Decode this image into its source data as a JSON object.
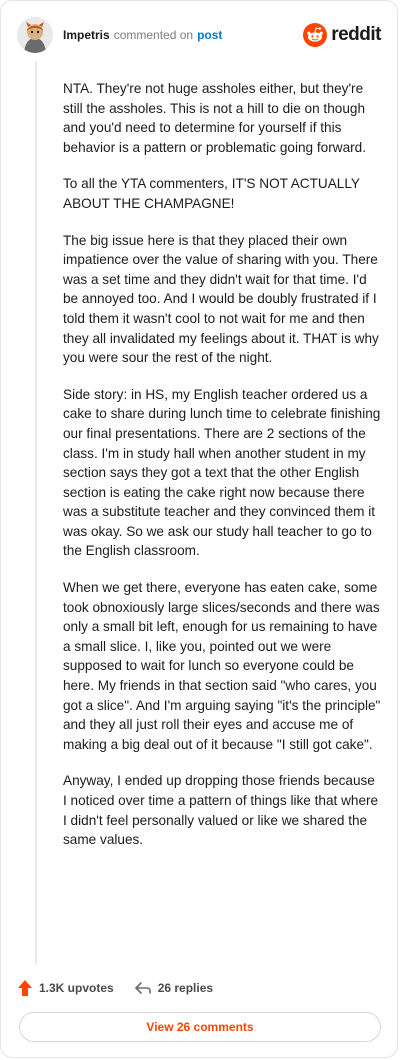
{
  "header": {
    "username": "Impetris",
    "verb": "commented on",
    "post_link": "post",
    "brand": "reddit"
  },
  "comment": {
    "paragraphs": [
      "NTA. They're not huge assholes either, but they're still the assholes. This is not a hill to die on though and you'd need to determine for yourself if this behavior is a pattern or problematic going forward.",
      "To all the YTA commenters, IT'S NOT ACTUALLY ABOUT THE CHAMPAGNE!",
      "The big issue here is that they placed their own impatience over the value of sharing with you. There was a set time and they didn't wait for that time. I'd be annoyed too. And I would be doubly frustrated if I told them it wasn't cool to not wait for me and then they all invalidated my feelings about it. THAT is why you were sour the rest of the night.",
      "Side story: in HS, my English teacher ordered us a cake to share during lunch time to celebrate finishing our final presentations. There are 2 sections of the class. I'm in study hall when another student in my section says they got a text that the other English section is eating the cake right now because there was a substitute teacher and they convinced them it was okay. So we ask our study hall teacher to go to the English classroom.",
      "When we get there, everyone has eaten cake, some took obnoxiously large slices/seconds and there was only a small bit left, enough for us remaining to have a small slice. I, like you, pointed out we were supposed to wait for lunch so everyone could be here. My friends in that section said \"who cares, you got a slice\". And I'm arguing saying \"it's the principle\" and they all just roll their eyes and accuse me of making a big deal out of it because \"I still got cake\".",
      "Anyway, I ended up dropping those friends because I noticed over time a pattern of things like that where I didn't feel personally valued or like we shared the same values."
    ]
  },
  "actions": {
    "upvotes": "1.3K upvotes",
    "replies": "26 replies"
  },
  "footer": {
    "view_comments": "View 26 comments"
  },
  "icons": {
    "avatar": "avatar-icon",
    "brand": "reddit-logo-icon",
    "upvote": "upvote-arrow-icon",
    "reply": "reply-arrow-icon"
  },
  "colors": {
    "brand": "#ff4500",
    "link": "#0079d3",
    "text": "#1a1a1b",
    "muted": "#7c7c7c"
  }
}
